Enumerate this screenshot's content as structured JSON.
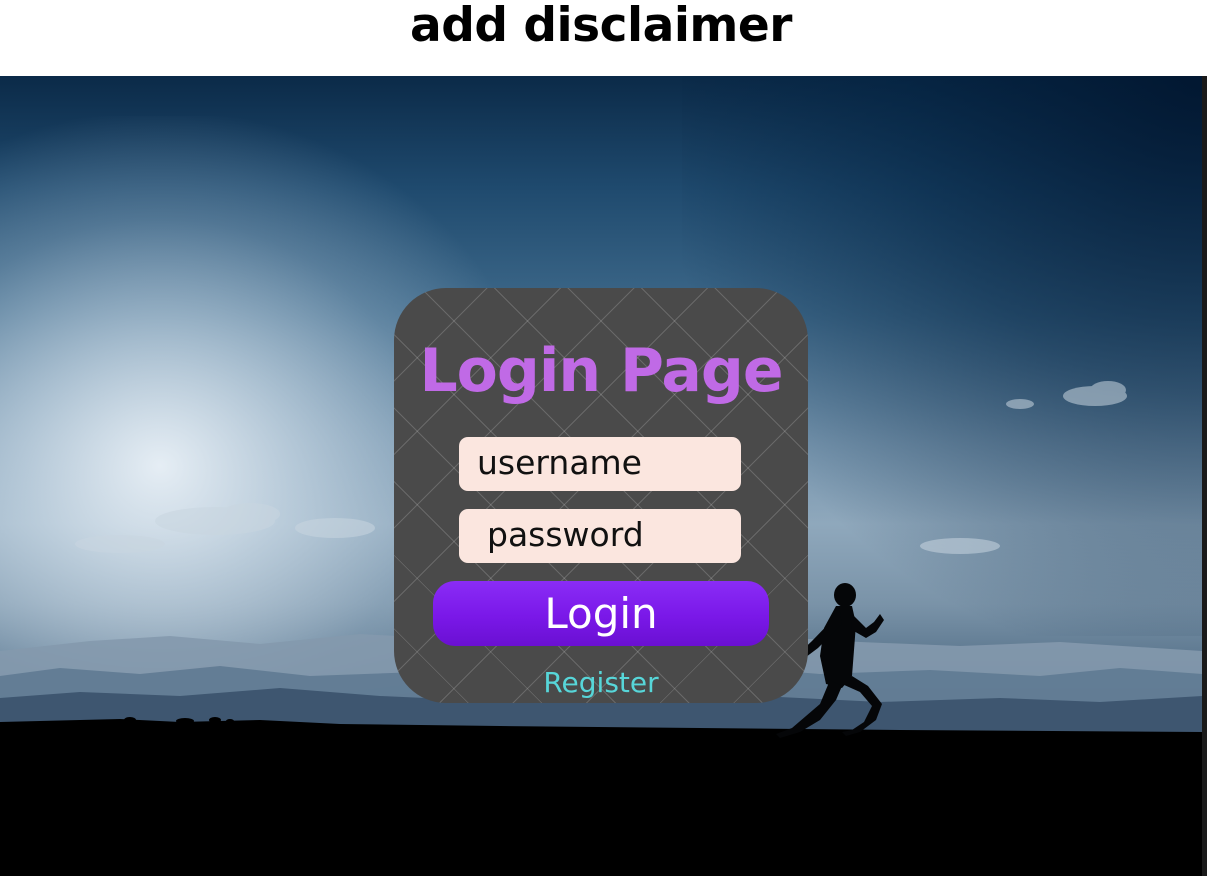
{
  "header": {
    "title": "add disclaimer"
  },
  "login": {
    "title": "Login Page",
    "username_placeholder": "username",
    "password_placeholder": "password",
    "button_label": "Login",
    "register_label": "Register"
  },
  "colors": {
    "title": "#c06ae6",
    "card": "#4a4a4a",
    "field": "#fbe6df",
    "button": "#7a18e8",
    "register": "#57d6d9"
  },
  "icons": {
    "background": "runner-silhouette"
  }
}
